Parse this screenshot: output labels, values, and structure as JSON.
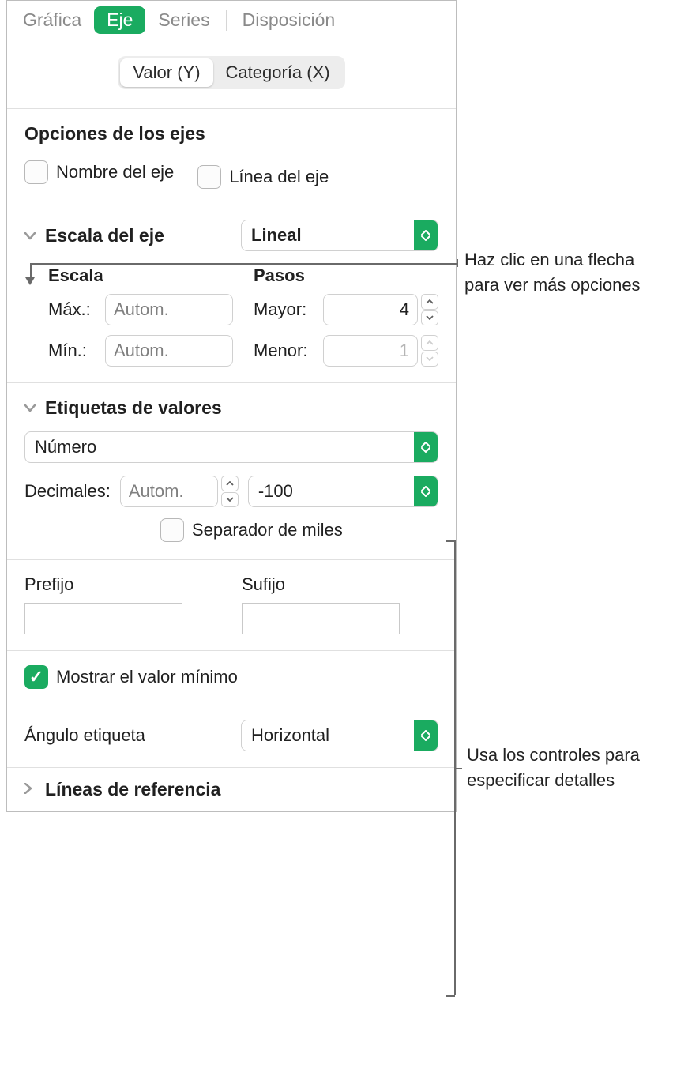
{
  "top_tabs": {
    "chart": "Gráfica",
    "axis": "Eje",
    "series": "Series",
    "layout": "Disposición"
  },
  "subtabs": {
    "value_y": "Valor (Y)",
    "category_x": "Categoría (X)"
  },
  "axis_options": {
    "heading": "Opciones de los ejes",
    "axis_name_label": "Nombre del eje",
    "axis_line_label": "Línea del eje"
  },
  "axis_scale": {
    "heading": "Escala del eje",
    "popup_value": "Lineal",
    "scale_heading": "Escala",
    "steps_heading": "Pasos",
    "max_label": "Máx.:",
    "min_label": "Mín.:",
    "auto_placeholder": "Autom.",
    "major_label": "Mayor:",
    "minor_label": "Menor:",
    "major_value": "4",
    "minor_value": "1"
  },
  "value_labels": {
    "heading": "Etiquetas de valores",
    "format_popup": "Número",
    "decimals_label": "Decimales:",
    "decimals_placeholder": "Autom.",
    "neg_popup": "-100",
    "thousands_label": "Separador de miles",
    "prefix_label": "Prefijo",
    "suffix_label": "Sufijo",
    "show_min_label": "Mostrar el valor mínimo",
    "angle_label": "Ángulo etiqueta",
    "angle_popup": "Horizontal"
  },
  "reference_lines": {
    "heading": "Líneas de referencia"
  },
  "callouts": {
    "arrow": "Haz clic en una flecha para ver más opciones",
    "controls": "Usa los controles para especificar detalles"
  }
}
